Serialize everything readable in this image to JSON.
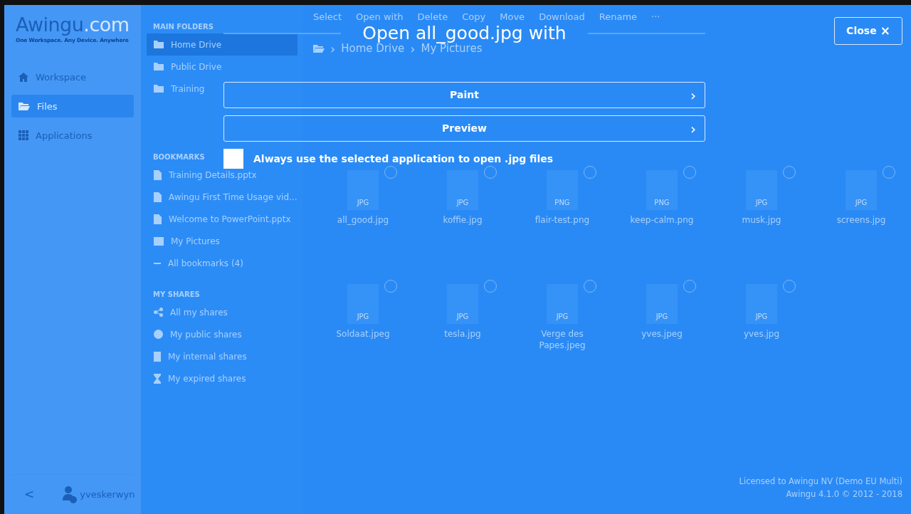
{
  "sidebar": {
    "logo": {
      "name": "Awingu",
      "suffix": ".com"
    },
    "tagline": "One Workspace. Any Device. Anywhere",
    "items": [
      {
        "label": "Workspace",
        "selected": false
      },
      {
        "label": "Files",
        "selected": true
      },
      {
        "label": "Applications",
        "selected": false
      }
    ],
    "collapse": "<",
    "user": "yveskerwyn"
  },
  "folders": [
    {
      "title": "MAIN FOLDERS",
      "items": [
        {
          "label": "Home Drive",
          "selected": true
        },
        {
          "label": "Public Drive",
          "selected": false
        },
        {
          "label": "Training",
          "selected": false
        }
      ]
    },
    {
      "title": "BOOKMARKS",
      "items": [
        {
          "label": "Training Details.pptx",
          "selected": false
        },
        {
          "label": "Awingu First Time Usage vid...",
          "selected": false
        },
        {
          "label": "Welcome to PowerPoint.pptx",
          "selected": false
        },
        {
          "label": "My Pictures",
          "selected": false
        },
        {
          "label": "All bookmarks (4)",
          "selected": false
        }
      ]
    },
    {
      "title": "MY SHARES",
      "items": [
        {
          "label": "All my shares",
          "selected": false
        },
        {
          "label": "My public shares",
          "selected": false
        },
        {
          "label": "My internal shares",
          "selected": false
        },
        {
          "label": "My expired shares",
          "selected": false
        }
      ]
    }
  ],
  "toolbar": [
    "Select",
    "Open with",
    "Delete",
    "Copy",
    "Move",
    "Download",
    "Rename",
    "···"
  ],
  "breadcrumb": [
    "Home Drive",
    "My Pictures"
  ],
  "files": [
    {
      "name": "all_good.jpg",
      "type": "JPG"
    },
    {
      "name": "koffie.jpg",
      "type": "JPG"
    },
    {
      "name": "flair-test.png",
      "type": "PNG"
    },
    {
      "name": "keep-calm.png",
      "type": "PNG"
    },
    {
      "name": "musk.jpg",
      "type": "JPG"
    },
    {
      "name": "screens.jpg",
      "type": "JPG"
    },
    {
      "name": "Soldaat.jpeg",
      "type": "JPG"
    },
    {
      "name": "tesla.jpg",
      "type": "JPG"
    },
    {
      "name": "Verge des Papes.jpeg",
      "type": "JPG"
    },
    {
      "name": "yves.jpeg",
      "type": "JPG"
    },
    {
      "name": "yves.jpg",
      "type": "JPG"
    }
  ],
  "footer": [
    "Licensed to Awingu NV (Demo EU Multi)",
    "Awingu 4.1.0 © 2012 - 2018"
  ],
  "dialog": {
    "title": "Open all_good.jpg with",
    "close": "Close",
    "close_icon": "×",
    "options": [
      {
        "label": "Paint",
        "arrow": "›"
      },
      {
        "label": "Preview",
        "arrow": "›"
      }
    ],
    "remember": {
      "label": "Always use the selected application to open .jpg files",
      "checked": false
    }
  }
}
